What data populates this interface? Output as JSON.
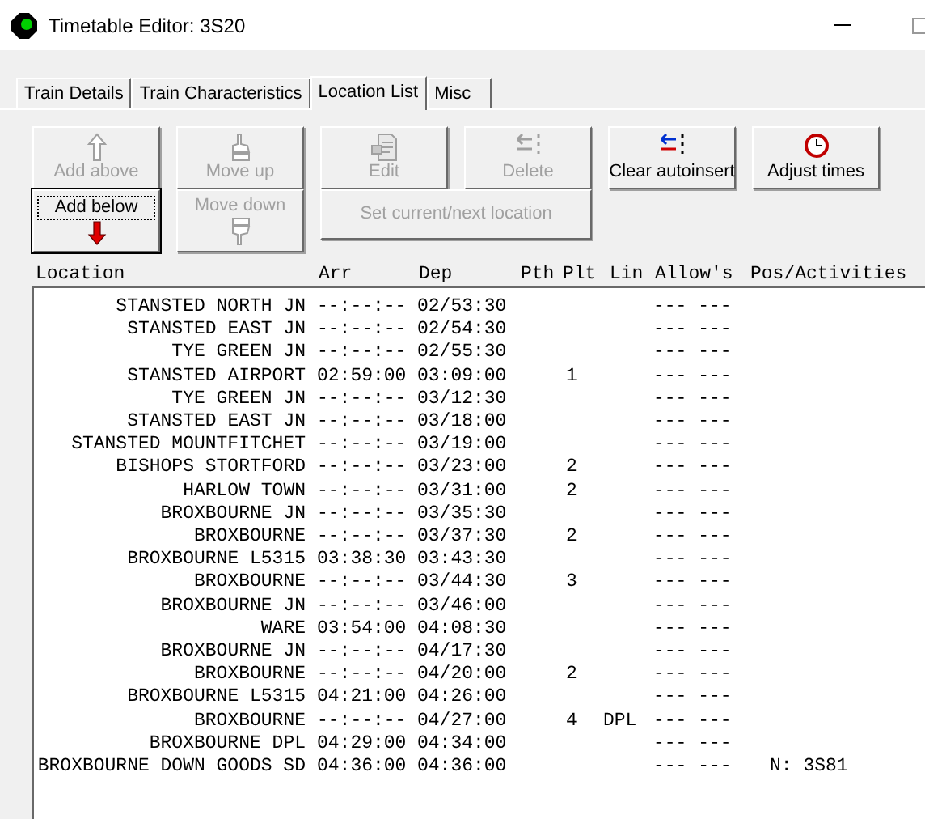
{
  "window": {
    "title": "Timetable Editor: 3S20"
  },
  "tabs": [
    {
      "label": "Train Details",
      "selected": false
    },
    {
      "label": "Train Characteristics",
      "selected": false
    },
    {
      "label": "Location List",
      "selected": true
    },
    {
      "label": "Misc",
      "selected": false
    }
  ],
  "buttons": [
    {
      "label": "Add above",
      "kind": "icon-top",
      "disabled": true,
      "focused": false
    },
    {
      "label": "Move up",
      "kind": "icon-top",
      "disabled": true,
      "focused": false
    },
    {
      "label": "Edit",
      "kind": "icon-top",
      "disabled": true,
      "focused": false
    },
    {
      "label": "Delete",
      "kind": "icon-top",
      "disabled": true,
      "focused": false
    },
    {
      "label": "Clear autoinsert",
      "kind": "icon-top",
      "disabled": false,
      "focused": false
    },
    {
      "label": "Adjust times",
      "kind": "icon-top",
      "disabled": false,
      "focused": false
    },
    {
      "label": "Add below",
      "kind": "icon-bottom",
      "disabled": false,
      "focused": true
    },
    {
      "label": "Move down",
      "kind": "icon-bottom",
      "disabled": true,
      "focused": false
    },
    {
      "label": "Set current/next location",
      "kind": "text-only",
      "disabled": true,
      "focused": false
    }
  ],
  "table": {
    "columns": [
      "Location",
      "Arr",
      "Dep",
      "Pth",
      "Plt",
      "Lin",
      "Allow's",
      "Pos/Activities"
    ],
    "rows": [
      {
        "location": "STANSTED NORTH JN",
        "arr": "--:--:--",
        "dep": "02/53:30",
        "allowances": "--- ---"
      },
      {
        "location": "STANSTED EAST JN",
        "arr": "--:--:--",
        "dep": "02/54:30",
        "allowances": "--- ---"
      },
      {
        "location": "TYE GREEN JN",
        "arr": "--:--:--",
        "dep": "02/55:30",
        "allowances": "--- ---"
      },
      {
        "location": "STANSTED AIRPORT",
        "arr": "02:59:00",
        "dep": "03:09:00",
        "plt": "1",
        "allowances": "--- ---"
      },
      {
        "location": "TYE GREEN JN",
        "arr": "--:--:--",
        "dep": "03/12:30",
        "allowances": "--- ---"
      },
      {
        "location": "STANSTED EAST JN",
        "arr": "--:--:--",
        "dep": "03/18:00",
        "allowances": "--- ---"
      },
      {
        "location": "STANSTED MOUNTFITCHET",
        "arr": "--:--:--",
        "dep": "03/19:00",
        "allowances": "--- ---"
      },
      {
        "location": "BISHOPS STORTFORD",
        "arr": "--:--:--",
        "dep": "03/23:00",
        "plt": "2",
        "allowances": "--- ---"
      },
      {
        "location": "HARLOW TOWN",
        "arr": "--:--:--",
        "dep": "03/31:00",
        "plt": "2",
        "allowances": "--- ---"
      },
      {
        "location": "BROXBOURNE JN",
        "arr": "--:--:--",
        "dep": "03/35:30",
        "allowances": "--- ---"
      },
      {
        "location": "BROXBOURNE",
        "arr": "--:--:--",
        "dep": "03/37:30",
        "plt": "2",
        "allowances": "--- ---"
      },
      {
        "location": "BROXBOURNE L5315",
        "arr": "03:38:30",
        "dep": "03:43:30",
        "allowances": "--- ---"
      },
      {
        "location": "BROXBOURNE",
        "arr": "--:--:--",
        "dep": "03/44:30",
        "plt": "3",
        "allowances": "--- ---"
      },
      {
        "location": "BROXBOURNE JN",
        "arr": "--:--:--",
        "dep": "03/46:00",
        "allowances": "--- ---"
      },
      {
        "location": "WARE",
        "arr": "03:54:00",
        "dep": "04:08:30",
        "allowances": "--- ---"
      },
      {
        "location": "BROXBOURNE JN",
        "arr": "--:--:--",
        "dep": "04/17:30",
        "allowances": "--- ---"
      },
      {
        "location": "BROXBOURNE",
        "arr": "--:--:--",
        "dep": "04/20:00",
        "plt": "2",
        "allowances": "--- ---"
      },
      {
        "location": "BROXBOURNE L5315",
        "arr": "04:21:00",
        "dep": "04:26:00",
        "allowances": "--- ---"
      },
      {
        "location": "BROXBOURNE",
        "arr": "--:--:--",
        "dep": "04/27:00",
        "plt": "4",
        "lin": "DPL",
        "allowances": "--- ---"
      },
      {
        "location": "BROXBOURNE DPL",
        "arr": "04:29:00",
        "dep": "04:34:00",
        "allowances": "--- ---"
      },
      {
        "location": "BROXBOURNE DOWN GOODS SD",
        "arr": "04:36:00",
        "dep": "04:36:00",
        "allowances": "--- ---",
        "activity": "N: 3S81"
      }
    ]
  }
}
